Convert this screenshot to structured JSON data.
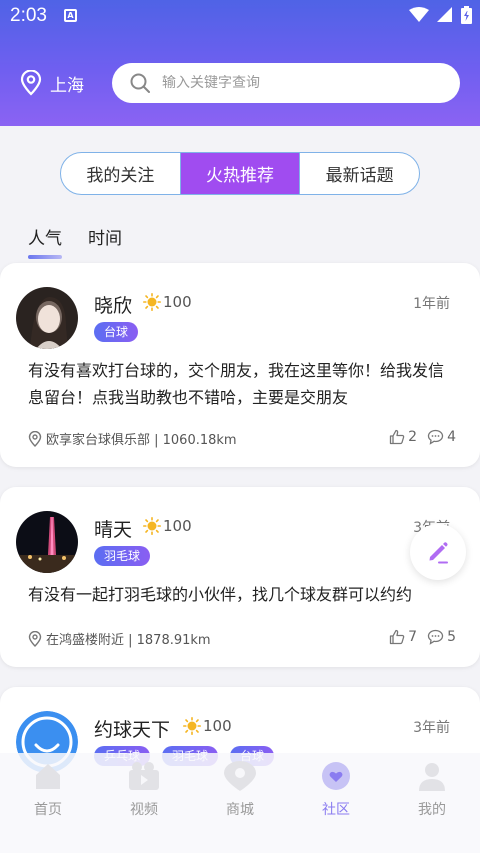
{
  "status_bar": {
    "time": "2:03",
    "indicator": "A"
  },
  "location": {
    "city": "上海"
  },
  "search": {
    "placeholder": "输入关键字查询"
  },
  "tabs": [
    {
      "label": "我的关注",
      "active": false
    },
    {
      "label": "火热推荐",
      "active": true
    },
    {
      "label": "最新话题",
      "active": false
    }
  ],
  "sort": {
    "popular": "人气",
    "time": "时间",
    "active": "人气"
  },
  "posts": [
    {
      "username": "晓欣",
      "level": "100",
      "time_ago": "1年前",
      "tags": [
        "台球"
      ],
      "content": "有没有喜欢打台球的，交个朋友，我在这里等你！给我发信息留台！点我当助教也不错哈，主要是交朋友",
      "location": "欧享家台球俱乐部 | 1060.18km",
      "likes": "2",
      "comments": "4"
    },
    {
      "username": "晴天",
      "level": "100",
      "time_ago": "3年前",
      "tags": [
        "羽毛球"
      ],
      "content": "有没有一起打羽毛球的小伙伴，找几个球友群可以约约",
      "location": "在鸿盛楼附近 | 1878.91km",
      "likes": "7",
      "comments": "5"
    },
    {
      "username": "约球天下",
      "level": "100",
      "time_ago": "3年前",
      "tags": [
        "乒乓球",
        "羽毛球",
        "台球"
      ]
    }
  ],
  "bottom_nav": [
    {
      "label": "首页",
      "icon": "home-icon",
      "active": false
    },
    {
      "label": "视频",
      "icon": "video-icon",
      "active": false
    },
    {
      "label": "商城",
      "icon": "shop-icon",
      "active": false
    },
    {
      "label": "社区",
      "icon": "community-icon",
      "active": true
    },
    {
      "label": "我的",
      "icon": "profile-icon",
      "active": false
    }
  ],
  "colors": {
    "header_start": "#4f63e6",
    "header_end": "#8b63f3",
    "tab_active": "#a04cf0",
    "tag": "#6a66f2",
    "nav_active": "#8a7cf0"
  }
}
